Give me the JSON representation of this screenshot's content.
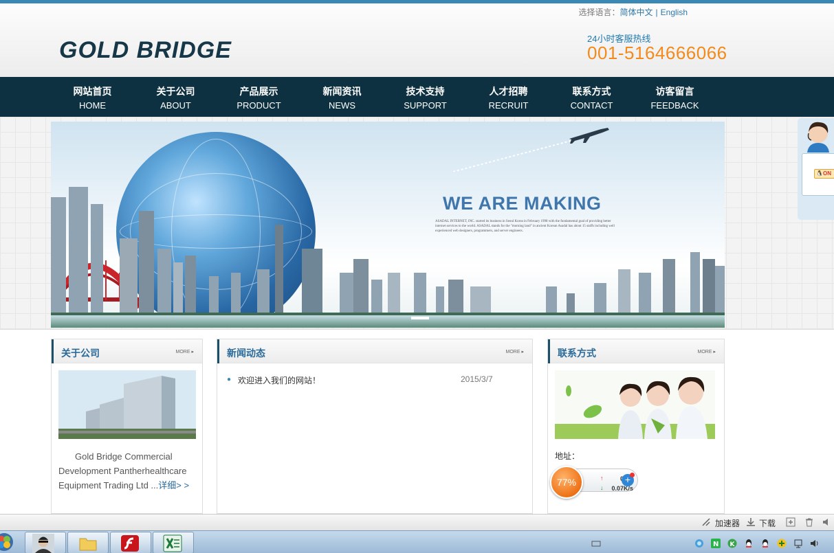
{
  "header": {
    "lang_label": "选择语言：",
    "lang_cn": "简体中文",
    "lang_sep": "|",
    "lang_en": "English",
    "logo": "GOLD  BRIDGE",
    "hotline_label": "24小时客服热线",
    "hotline_number": "001-5164666066"
  },
  "nav": [
    {
      "cn": "网站首页",
      "en": "HOME"
    },
    {
      "cn": "关于公司",
      "en": "ABOUT"
    },
    {
      "cn": "产品展示",
      "en": "PRODUCT"
    },
    {
      "cn": "新闻资讯",
      "en": "NEWS"
    },
    {
      "cn": "技术支持",
      "en": "SUPPORT"
    },
    {
      "cn": "人才招聘",
      "en": "RECRUIT"
    },
    {
      "cn": "联系方式",
      "en": "CONTACT"
    },
    {
      "cn": "访客留言",
      "en": "FEEDBACK"
    }
  ],
  "banner": {
    "headline": "WE ARE MAKING",
    "subtext": "ASADAL INTERNET, INC. started its business in Seoul Korea in February 1998 with the fundamental goal of providing better internet services to the world. ASADAL stands for the \"morning land\" in ancient Korean Asadal has about 15 staffs including well experienced web designers, programmers, and server engineers."
  },
  "side_service": {
    "qq_label": "ON"
  },
  "panels": {
    "about": {
      "title": "关于公司",
      "more": "MORE ▸",
      "text": "Gold Bridge Commercial Development Pantherhealthcare Equipment Trading Ltd ...",
      "detail_link": "详细> >"
    },
    "news": {
      "title": "新闻动态",
      "more": "MORE ▸",
      "items": [
        {
          "title": "欢迎进入我们的网站！",
          "date": "2015/3/7"
        }
      ]
    },
    "contact": {
      "title": "联系方式",
      "more": "MORE ▸",
      "address_label": "地址："
    }
  },
  "speed_widget": {
    "percent": "77%",
    "upload": "0K/s",
    "download": "0.07K/s"
  },
  "download_bar": {
    "accelerator": "加速器",
    "download": "下载"
  }
}
